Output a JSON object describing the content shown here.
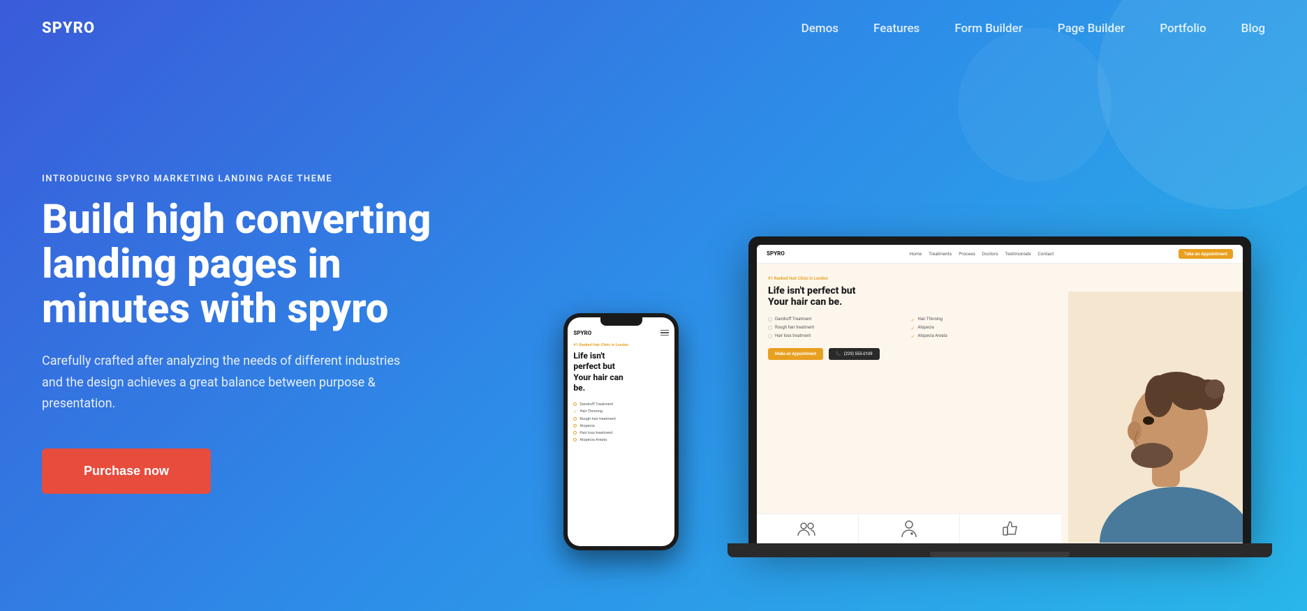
{
  "brand": {
    "logo": "SPYRO"
  },
  "nav": {
    "links": [
      {
        "label": "Demos",
        "href": "#"
      },
      {
        "label": "Features",
        "href": "#"
      },
      {
        "label": "Form Builder",
        "href": "#"
      },
      {
        "label": "Page Builder",
        "href": "#"
      },
      {
        "label": "Portfolio",
        "href": "#"
      },
      {
        "label": "Blog",
        "href": "#"
      }
    ]
  },
  "hero": {
    "tagline": "INTRODUCING SPYRO MARKETING LANDING PAGE THEME",
    "headline_line1": "Build high converting",
    "headline_line2": "landing pages in",
    "headline_line3": "minutes with spyro",
    "description": "Carefully crafted after analyzing the needs of different industries and the design achieves a great balance between purpose & presentation.",
    "cta_label": "Purchase now",
    "cta_color": "#e74c3c"
  },
  "laptop_demo": {
    "logo": "SPYRO",
    "nav_links": [
      "Home",
      "Treatments",
      "Process",
      "Doctors",
      "Testimonials",
      "Contact"
    ],
    "nav_btn": "Take an Appointment",
    "tagline": "#1 Ranked Hair Clinic in London",
    "headline": "Life isn't perfect but Your hair can be.",
    "features": [
      {
        "icon": "circle",
        "label": "Dandruff Treatment"
      },
      {
        "icon": "check",
        "label": "Hair Thinning"
      },
      {
        "icon": "circle",
        "label": "Rough hair treatment"
      },
      {
        "icon": "check",
        "label": "Alopecia"
      },
      {
        "icon": "circle",
        "label": "Hair loss treatment"
      },
      {
        "icon": "check",
        "label": "Alopecia Areata"
      }
    ],
    "btn_primary": "Make an Appointment",
    "btn_phone": "(229) 555-0109"
  },
  "phone_demo": {
    "logo": "SPYRO",
    "tagline": "#1 Ranked Hair Clinic in London",
    "headline": "Life isn't perfect but Your hair can be.",
    "features": [
      "Dandruff Treatment",
      "Hair Thinning",
      "Rough hair treatment",
      "Alopecia",
      "Hair loss treatment",
      "Alopecia Areata"
    ]
  },
  "colors": {
    "bg_gradient_start": "#3a5bd9",
    "bg_gradient_end": "#29b6e8",
    "accent": "#e8a020",
    "cta": "#e74c3c",
    "white": "#ffffff"
  }
}
